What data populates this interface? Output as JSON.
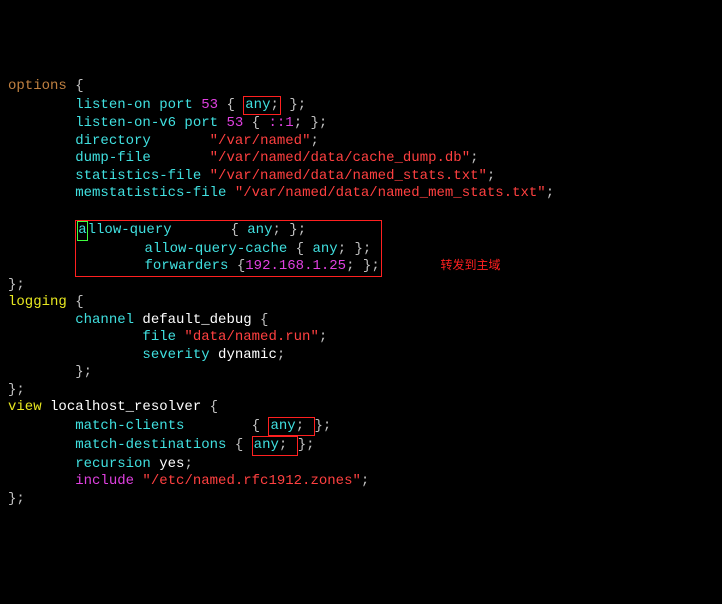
{
  "line1_options": "options",
  "brace_open": " {",
  "brace_close": "}",
  "semi": ";",
  "listen_on": "listen-on port",
  "listen_on_port": " 53",
  "listen_on_v6": "listen-on-v6 port",
  "listen_on_v6_port": " 53",
  "listen_on_v6_addr": " ::1",
  "any": "any",
  "directory": "directory",
  "directory_val": "\"/var/named\"",
  "dump_file": "dump-file",
  "dump_file_val": "\"/var/named/data/cache_dump.db\"",
  "stats_file": "statistics-file",
  "stats_file_val": " \"/var/named/data/named_stats.txt\"",
  "memstats_file": "memstatistics-file",
  "memstats_file_val": " \"/var/named/data/named_mem_stats.txt\"",
  "allow_a": "a",
  "allow_query_rest": "llow-query      ",
  "allow_query_cache": "allow-query-cache",
  "forwarders": "forwarders",
  "forwarders_ip": "192.168.1.25",
  "annotation": "转发到主域",
  "logging": "logging",
  "channel": "channel",
  "default_debug": " default_debug",
  "file_kw": "file",
  "file_val": " \"data/named.run\"",
  "severity": "severity",
  "severity_val": " dynamic",
  "view": "view",
  "localhost_resolver": " localhost_resolver",
  "match_clients": "match-clients     ",
  "match_destinations": "match-destinations",
  "recursion": "recursion",
  "recursion_val": " yes",
  "include": "include",
  "include_val": " \"/etc/named.rfc1912.zones\""
}
